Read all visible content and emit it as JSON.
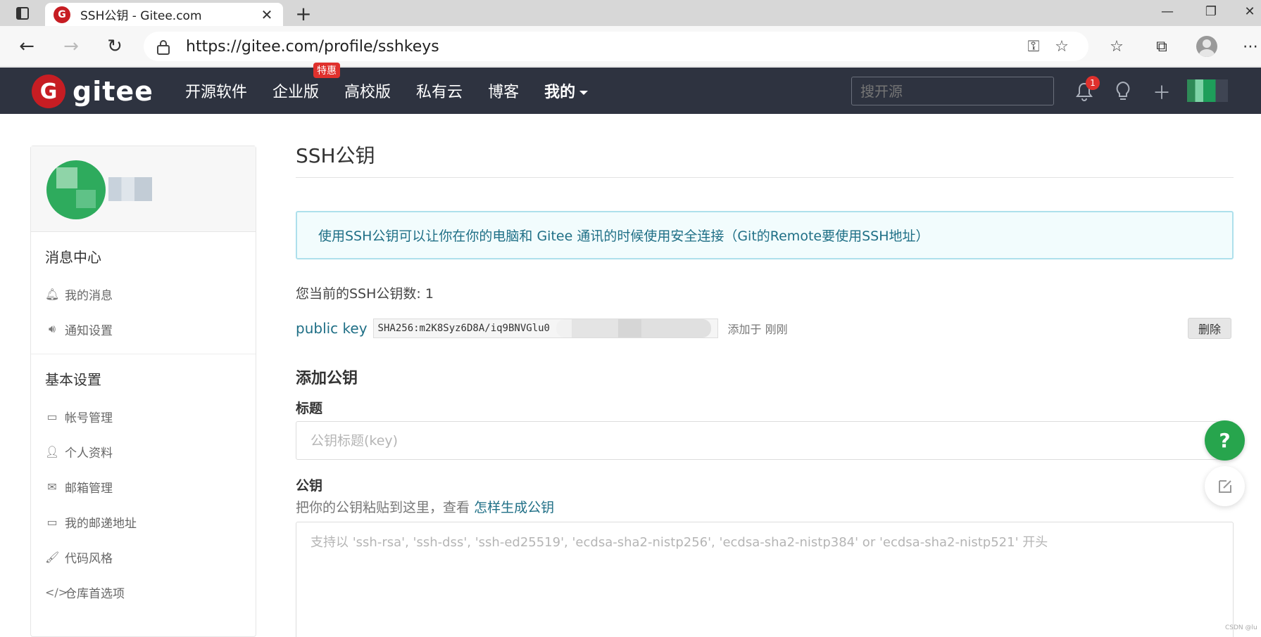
{
  "browser": {
    "tab_title": "SSH公钥 - Gitee.com",
    "favicon_letter": "G",
    "url": "https://gitee.com/profile/sshkeys"
  },
  "header": {
    "logo_letter": "G",
    "logo_text": "gitee",
    "nav": [
      {
        "label": "开源软件"
      },
      {
        "label": "企业版",
        "badge": "特惠"
      },
      {
        "label": "高校版"
      },
      {
        "label": "私有云"
      },
      {
        "label": "博客"
      },
      {
        "label": "我的"
      }
    ],
    "search_placeholder": "搜开源",
    "notification_count": "1"
  },
  "sidebar": {
    "groups": [
      {
        "heading": "消息中心",
        "items": [
          {
            "label": "我的消息",
            "icon": "bell-icon"
          },
          {
            "label": "通知设置",
            "icon": "speaker-icon"
          }
        ]
      },
      {
        "heading": "基本设置",
        "items": [
          {
            "label": "帐号管理",
            "icon": "id-card-icon"
          },
          {
            "label": "个人资料",
            "icon": "user-icon"
          },
          {
            "label": "邮箱管理",
            "icon": "envelope-icon"
          },
          {
            "label": "我的邮递地址",
            "icon": "address-card-icon"
          },
          {
            "label": "代码风格",
            "icon": "brush-icon"
          },
          {
            "label": "仓库首选项",
            "icon": "code-icon"
          }
        ]
      }
    ]
  },
  "main": {
    "title": "SSH公钥",
    "info": "使用SSH公钥可以让你在你的电脑和 Gitee 通讯的时候使用安全连接（Git的Remote要使用SSH地址）",
    "key_count_text": "您当前的SSH公钥数: 1",
    "keys": [
      {
        "label": "public key",
        "fingerprint": "SHA256:m2K8Syz6D8A/iq9BNVGlu0",
        "added": "添加于 刚刚",
        "delete_label": "删除"
      }
    ],
    "add_section_title": "添加公钥",
    "title_field_label": "标题",
    "title_field_placeholder": "公钥标题(key)",
    "key_field_label": "公钥",
    "key_field_help": "把你的公钥粘贴到这里，查看",
    "key_field_help_link": "怎样生成公钥",
    "key_field_placeholder": "支持以 'ssh-rsa', 'ssh-dss', 'ssh-ed25519', 'ecdsa-sha2-nistp256', 'ecdsa-sha2-nistp384' or 'ecdsa-sha2-nistp521' 开头"
  },
  "floating": {
    "help_label": "?"
  },
  "watermark": "CSDN @lu"
}
